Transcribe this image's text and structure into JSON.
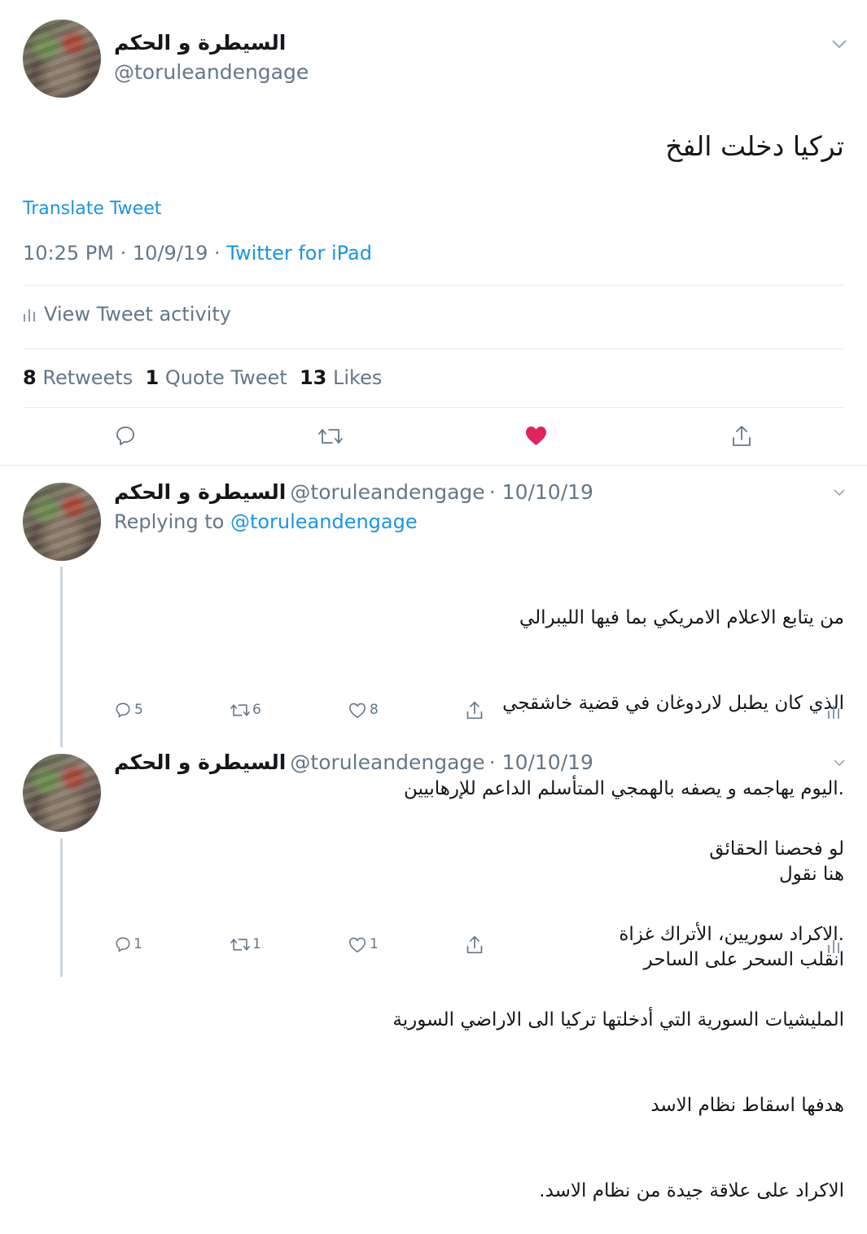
{
  "main_tweet": {
    "display_name": "السيطرة و الحكم",
    "handle": "@toruleandengage",
    "text": "تركيا دخلت الفخ",
    "translate_label": "Translate Tweet",
    "timestamp": "10:25 PM · 10/9/19 · ",
    "source": "Twitter for iPad",
    "activity_label": "View Tweet activity",
    "stats": {
      "retweets_count": "8",
      "retweets_label": "Retweets",
      "quotes_count": "1",
      "quotes_label": "Quote Tweet",
      "likes_count": "13",
      "likes_label": "Likes"
    }
  },
  "replies": [
    {
      "display_name": "السيطرة و الحكم",
      "handle": "@toruleandengage",
      "date": "· 10/10/19",
      "replying_label": "Replying to ",
      "replying_handle": "@toruleandengage",
      "lines": [
        "من يتابع الاعلام الامريكي بما فيها الليبرالي",
        "الذي كان يطبل لاردوغان في قضية خاشقجي",
        ".اليوم يهاجمه و يصفه بالهمجي المتأسلم الداعم للإرهابيين",
        "هنا نقول",
        "انقلب السحر على الساحر"
      ],
      "reply_count": "5",
      "retweet_count": "6",
      "like_count": "8"
    },
    {
      "display_name": "السيطرة و الحكم",
      "handle": "@toruleandengage",
      "date": "· 10/10/19",
      "lines": [
        "لو فحصنا الحقائق",
        ".الاكراد سوريين، الأتراك غزاة",
        "المليشيات السورية التي أدخلتها تركيا الى الاراضي السورية",
        "هدفها اسقاط نظام الاسد",
        "الاكراد على علاقة جيدة من نظام الاسد."
      ],
      "reply_count": "1",
      "retweet_count": "1",
      "like_count": "1"
    }
  ],
  "colors": {
    "accent": "#1b95e0",
    "like": "#e0245e",
    "muted": "#657786"
  }
}
